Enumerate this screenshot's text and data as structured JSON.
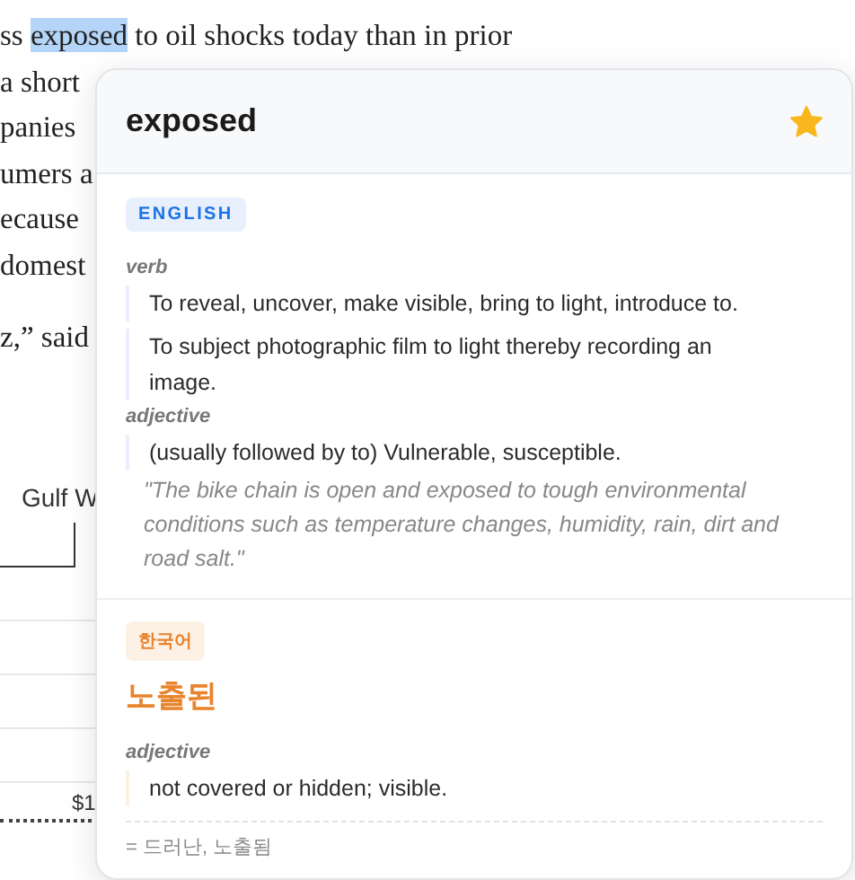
{
  "article": {
    "lines": [
      {
        "before": "ss ",
        "highlighted": "exposed",
        "after": " to oil shocks today than in prior"
      },
      {
        "before": "a short"
      },
      {
        "before": "panies"
      },
      {
        "before": "umers a"
      },
      {
        "before": "ecause"
      },
      {
        "before": "domest"
      },
      {
        "before": "z,” said"
      }
    ]
  },
  "chart": {
    "label": "Gulf W",
    "value_label": "$1"
  },
  "popup": {
    "word": "exposed",
    "starred": true,
    "sections": [
      {
        "language": "ENGLISH",
        "kind": "source",
        "groups": [
          {
            "pos": "verb",
            "senses": [
              {
                "text": "To reveal, uncover, make visible, bring to light, introduce to."
              },
              {
                "text": "To subject photographic film to light thereby recording an image."
              }
            ]
          },
          {
            "pos": "adjective",
            "senses": [
              {
                "text": "(usually followed by to) Vulnerable, susceptible."
              }
            ],
            "example": "\"The bike chain is open and exposed to tough environmental conditions such as temperature changes, humidity, rain, dirt and road salt.\""
          }
        ]
      },
      {
        "language": "한국어",
        "kind": "target",
        "translation": "노출된",
        "groups": [
          {
            "pos": "adjective",
            "senses": [
              {
                "text": "not covered or hidden; visible."
              }
            ]
          }
        ],
        "synonyms": "= 드러난, 노출됨"
      }
    ]
  }
}
